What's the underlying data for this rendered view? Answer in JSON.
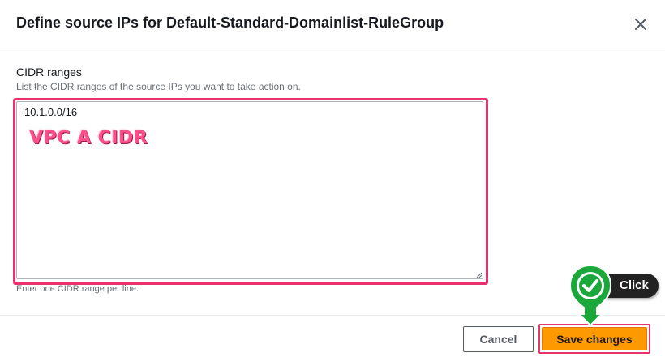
{
  "modal": {
    "title": "Define source IPs for Default-Standard-Domainlist-RuleGroup"
  },
  "field": {
    "label": "CIDR ranges",
    "description": "List the CIDR ranges of the source IPs you want to take action on.",
    "value": "10.1.0.0/16",
    "hint": "Enter one CIDR range per line."
  },
  "annotation": {
    "text": "VPC A CIDR",
    "click_label": "Click",
    "highlight_color": "#e8336e",
    "marker_color": "#1aa83a"
  },
  "footer": {
    "cancel_label": "Cancel",
    "save_label": "Save changes",
    "primary_color": "#ff9900"
  },
  "icons": {
    "close": "close-icon",
    "check": "check-icon"
  }
}
